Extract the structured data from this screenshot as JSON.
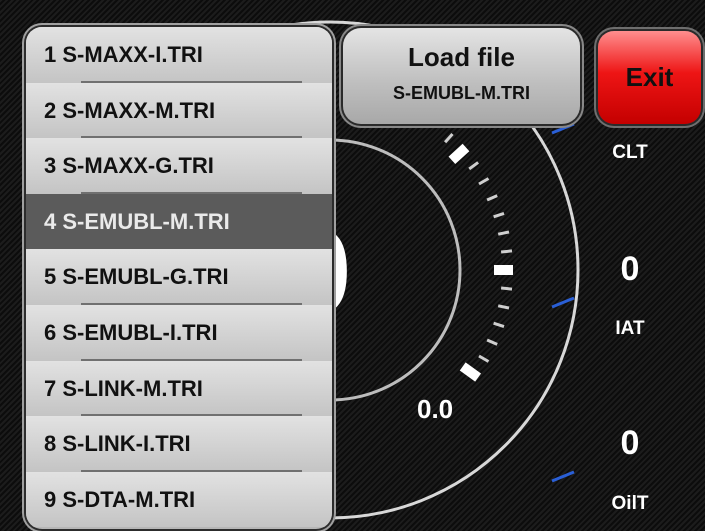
{
  "menu": {
    "items": [
      {
        "label": "1 S-MAXX-I.TRI"
      },
      {
        "label": "2 S-MAXX-M.TRI"
      },
      {
        "label": "3 S-MAXX-G.TRI"
      },
      {
        "label": "4 S-EMUBL-M.TRI"
      },
      {
        "label": "5 S-EMUBL-G.TRI"
      },
      {
        "label": "6 S-EMUBL-I.TRI"
      },
      {
        "label": "7 S-LINK-M.TRI"
      },
      {
        "label": "8 S-LINK-I.TRI"
      },
      {
        "label": "9 S-DTA-M.TRI"
      }
    ],
    "selected_index": 3
  },
  "load_button": {
    "title": "Load file",
    "file": "S-EMUBL-M.TRI"
  },
  "exit_button": {
    "label": "Exit"
  },
  "gauge": {
    "value_digit": "0",
    "speed_readout": "0.0"
  },
  "sensors": {
    "clt": {
      "label": "CLT"
    },
    "iat": {
      "label": "IAT",
      "value": "0"
    },
    "oilt": {
      "label": "OilT",
      "value": "0"
    }
  },
  "colors": {
    "exit_red": "#ee1515",
    "gauge_tick_blue": "#2a5fd6",
    "selected_row": "#5b5b5b"
  }
}
